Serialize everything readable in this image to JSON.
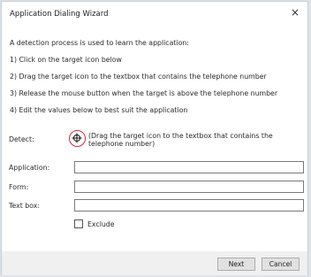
{
  "window": {
    "title": "Application Dialing Wizard",
    "close_glyph": "×"
  },
  "instructions": [
    "A detection process is used to learn the application:",
    "1) Click on the target icon below",
    "2) Drag the target icon to the textbox that contains the telephone number",
    "3) Release the mouse button when the target is above the telephone number",
    "4) Edit the values below to best suit the application"
  ],
  "detect": {
    "label": "Detect:",
    "icon": "crosshair-target-icon",
    "hint": "(Drag the target icon to the textbox that contains the telephone number)"
  },
  "fields": {
    "application": {
      "label": "Application:",
      "value": ""
    },
    "form": {
      "label": "Form:",
      "value": ""
    },
    "textbox": {
      "label": "Text box:",
      "value": ""
    }
  },
  "exclude": {
    "label": "Exclude",
    "checked": false
  },
  "buttons": {
    "next": "Next",
    "cancel": "Cancel"
  },
  "colors": {
    "target_ring": "#d8283a",
    "window_bg": "#ffffff",
    "footer_bg": "#f0f0f0"
  }
}
